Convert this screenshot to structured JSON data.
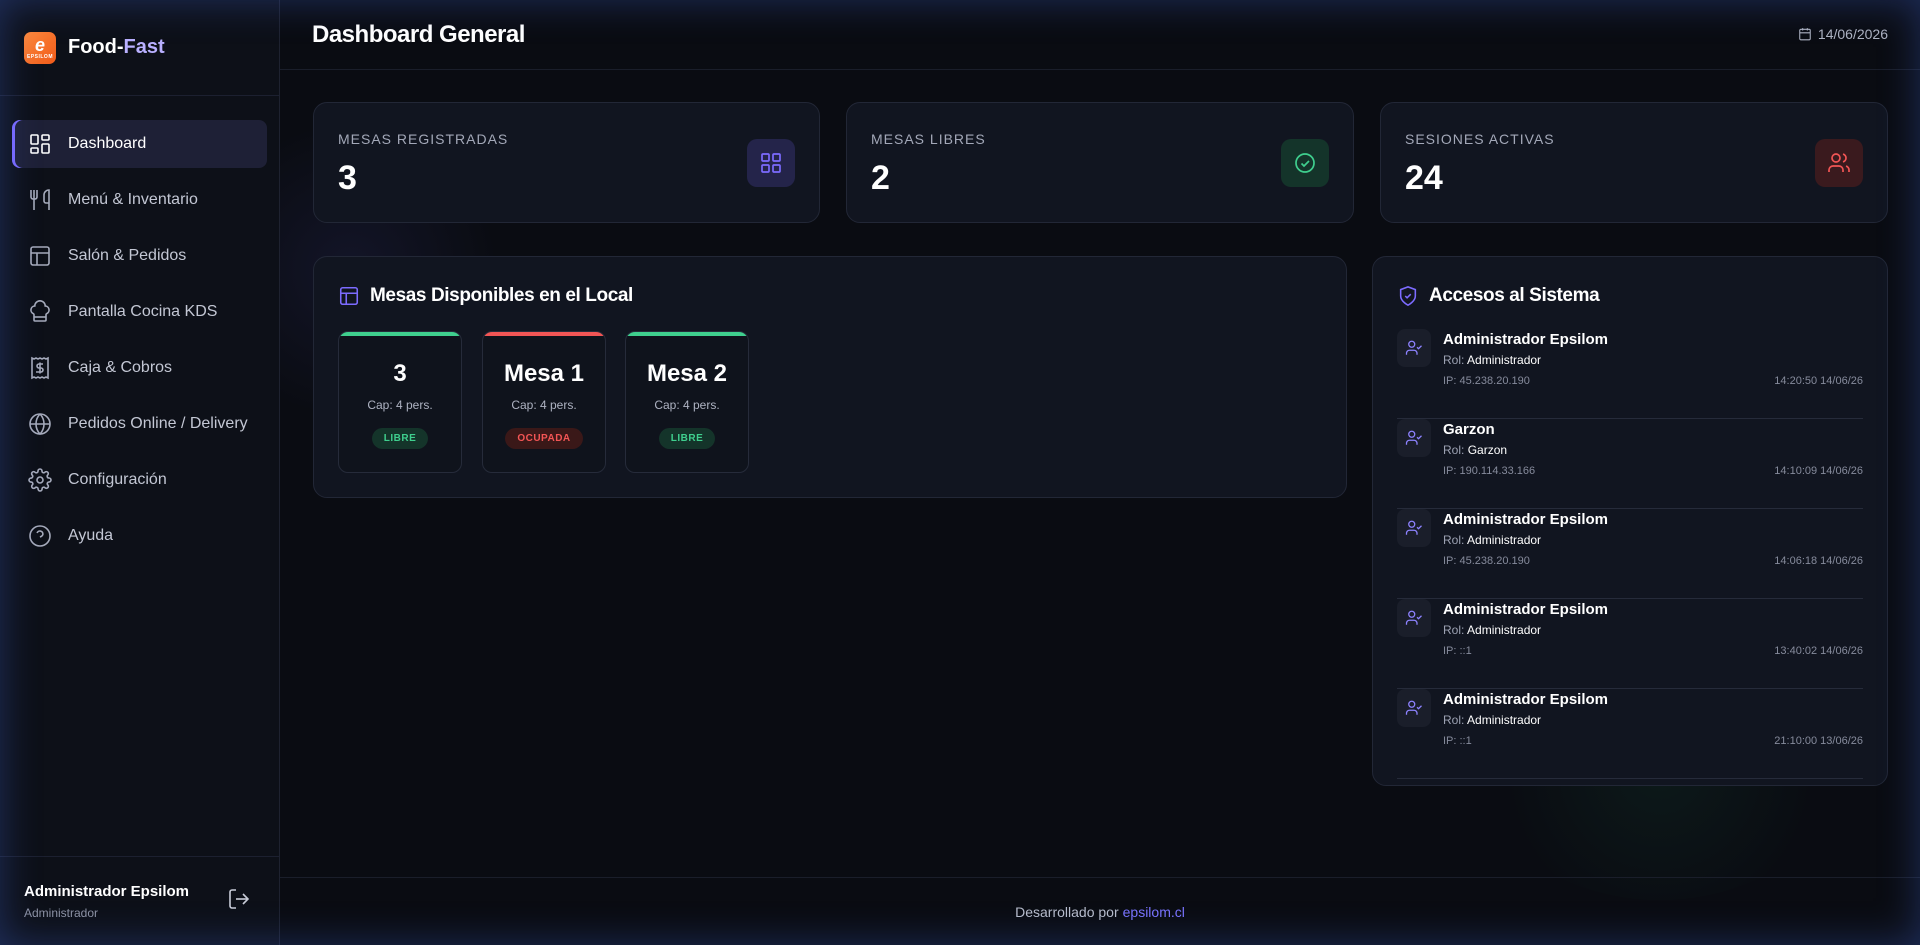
{
  "brand": {
    "logo_text": "e",
    "logo_sub": "EPSILOM",
    "name_part1": "Food-",
    "name_part2": "Fast"
  },
  "nav": [
    {
      "label": "Dashboard",
      "icon": "dashboard-grid-icon",
      "active": true
    },
    {
      "label": "Menú & Inventario",
      "icon": "utensils-icon"
    },
    {
      "label": "Salón & Pedidos",
      "icon": "layout-icon"
    },
    {
      "label": "Pantalla Cocina KDS",
      "icon": "chef-hat-icon"
    },
    {
      "label": "Caja & Cobros",
      "icon": "receipt-dollar-icon"
    },
    {
      "label": "Pedidos Online / Delivery",
      "icon": "globe-icon"
    },
    {
      "label": "Configuración",
      "icon": "gear-icon"
    },
    {
      "label": "Ayuda",
      "icon": "help-circle-icon"
    }
  ],
  "user": {
    "name": "Administrador Epsilom",
    "role": "Administrador"
  },
  "header": {
    "title": "Dashboard General",
    "date": "14/06/2026"
  },
  "stats": [
    {
      "label": "MESAS REGISTRADAS",
      "value": "3",
      "icon": "grid-icon",
      "color": "#7c6bff"
    },
    {
      "label": "MESAS LIBRES",
      "value": "2",
      "icon": "check-circle-icon",
      "color": "#3fcf8e"
    },
    {
      "label": "SESIONES ACTIVAS",
      "value": "24",
      "icon": "users-icon",
      "color": "#f25555"
    }
  ],
  "tables_section": {
    "title": "Mesas Disponibles en el Local",
    "tables": [
      {
        "name": "3",
        "capacity": "Cap: 4 pers.",
        "status": "LIBRE",
        "state": "libre"
      },
      {
        "name": "Mesa 1",
        "capacity": "Cap: 4 pers.",
        "status": "OCUPADA",
        "state": "ocupada"
      },
      {
        "name": "Mesa 2",
        "capacity": "Cap: 4 pers.",
        "status": "LIBRE",
        "state": "libre"
      }
    ]
  },
  "access_section": {
    "title": "Accesos al Sistema",
    "role_prefix": "Rol:",
    "items": [
      {
        "name": "Administrador Epsilom",
        "role": "Administrador",
        "ip": "IP: 45.238.20.190",
        "time": "14:20:50 14/06/26"
      },
      {
        "name": "Garzon",
        "role": "Garzon",
        "ip": "IP: 190.114.33.166",
        "time": "14:10:09 14/06/26"
      },
      {
        "name": "Administrador Epsilom",
        "role": "Administrador",
        "ip": "IP: 45.238.20.190",
        "time": "14:06:18 14/06/26"
      },
      {
        "name": "Administrador Epsilom",
        "role": "Administrador",
        "ip": "IP: ::1",
        "time": "13:40:02 14/06/26"
      },
      {
        "name": "Administrador Epsilom",
        "role": "Administrador",
        "ip": "IP: ::1",
        "time": "21:10:00 13/06/26"
      }
    ]
  },
  "footer": {
    "text": "Desarrollado por",
    "link": "epsilom.cl"
  },
  "colors": {
    "accent": "#7c6bff",
    "success": "#3fcf8e",
    "danger": "#f25555",
    "background": "#0a0c12"
  }
}
